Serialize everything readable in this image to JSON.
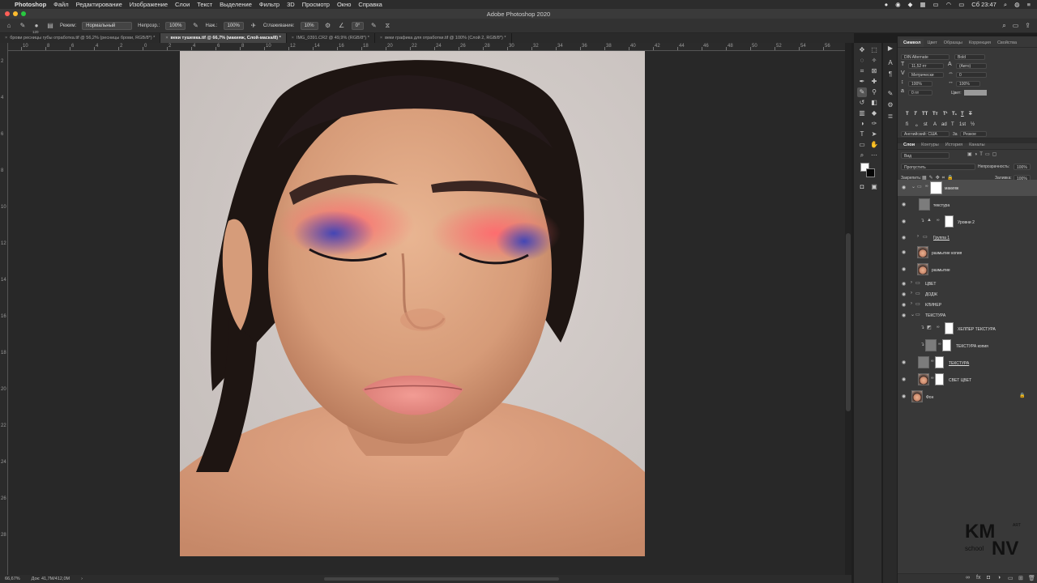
{
  "menubar": {
    "app": "Photoshop",
    "items": [
      "Файл",
      "Редактирование",
      "Изображение",
      "Слои",
      "Текст",
      "Выделение",
      "Фильтр",
      "3D",
      "Просмотр",
      "Окно",
      "Справка"
    ],
    "clock": "Сб 23:47"
  },
  "window": {
    "title": "Adobe Photoshop 2020"
  },
  "options": {
    "brush_size": "120",
    "mode_label": "Режим:",
    "mode_value": "Нормальный",
    "opacity_label": "Непрозр.:",
    "opacity_value": "100%",
    "flow_label": "Наж.:",
    "flow_value": "100%",
    "smoothing_label": "Сглаживание:",
    "smoothing_value": "10%",
    "angle_value": "0°"
  },
  "tabs": [
    {
      "label": "брови ресницы губы отработка.tif @ 56,2% (ресницы брови, RGB/8*) *",
      "active": false
    },
    {
      "label": "веки тушевка.tif @ 66,7% (макияж, Слой-маска/8) *",
      "active": true
    },
    {
      "label": "IMG_0391.CR2 @ 49,9% (RGB/8*) *",
      "active": false
    },
    {
      "label": "веки графика для отработки.tif @ 100% (Слой 2, RGB/8*) *",
      "active": false
    }
  ],
  "ruler": {
    "top": [
      "10",
      "8",
      "6",
      "4",
      "2",
      "0",
      "2",
      "4",
      "6",
      "8",
      "10",
      "12",
      "14",
      "16",
      "18",
      "20",
      "22",
      "24",
      "26",
      "28",
      "30",
      "32",
      "34",
      "36",
      "38",
      "40",
      "42",
      "44",
      "46",
      "48",
      "50",
      "52",
      "54",
      "56"
    ],
    "left": [
      "2",
      "4",
      "6",
      "8",
      "10",
      "12",
      "14",
      "16",
      "18",
      "20",
      "22",
      "24",
      "26",
      "28"
    ]
  },
  "status": {
    "zoom": "66,67%",
    "doc": "Док: 41,7M/412,0M"
  },
  "character": {
    "tabs": [
      "Символ",
      "Цвет",
      "Образцы",
      "Коррекция",
      "Свойства"
    ],
    "font": "DIN Alternate",
    "style": "Bold",
    "size": "11,52 пт",
    "leading": "(Авто)",
    "kerning": "Метрически",
    "tracking": "0",
    "vscale": "100%",
    "hscale": "100%",
    "baseline": "0 пт",
    "color_label": "Цвет:",
    "lang": "Английский: США",
    "aa_label": "3a",
    "aa": "Резкое",
    "type_buttons": [
      "T",
      "T",
      "TT",
      "Tт",
      "T¹",
      "T₁",
      "T",
      "T"
    ],
    "ot_buttons": [
      "fi",
      "ℴ",
      "st",
      "A",
      "ad",
      "T",
      "1st",
      "½"
    ]
  },
  "layers": {
    "tabs": [
      "Слои",
      "Контуры",
      "История",
      "Каналы"
    ],
    "filter": "Вид",
    "blend": "Пропустить",
    "opacity_label": "Непрозрачность:",
    "opacity": "100%",
    "lock_label": "Закрепить:",
    "fill_label": "Заливка:",
    "fill": "100%",
    "items": [
      {
        "name": "макияж",
        "kind": "group-mask",
        "selected": true
      },
      {
        "name": "текстура",
        "kind": "grey",
        "selected": false
      },
      {
        "name": "Уровни 2",
        "kind": "adjust",
        "selected": false
      },
      {
        "name": "Группа 1",
        "kind": "folder",
        "selected": false
      },
      {
        "name": "размытие копия",
        "kind": "face",
        "selected": false
      },
      {
        "name": "размытие",
        "kind": "face",
        "selected": false
      },
      {
        "name": "ЦВЕТ",
        "kind": "folder",
        "selected": false
      },
      {
        "name": "ДОДЖ",
        "kind": "folder",
        "selected": false
      },
      {
        "name": "КЛИНЕР",
        "kind": "folder",
        "selected": false
      },
      {
        "name": "ТЕКСТУРА",
        "kind": "folder-open",
        "selected": false
      },
      {
        "name": "ХЕЛПЕР ТЕКСТУРА",
        "kind": "adjust-mask",
        "selected": false
      },
      {
        "name": "ТЕКСТУРА копия",
        "kind": "grey-mask",
        "selected": false
      },
      {
        "name": "ТЕКСТУРА",
        "kind": "grey-mask",
        "selected": false
      },
      {
        "name": "СВЕТ ЦВЕТ",
        "kind": "face-mask",
        "selected": false
      },
      {
        "name": "Фон",
        "kind": "face-lock",
        "selected": false
      }
    ]
  },
  "watermark": {
    "line1": "KM",
    "line2": "NV",
    "word": "school",
    "tag": "ART"
  }
}
